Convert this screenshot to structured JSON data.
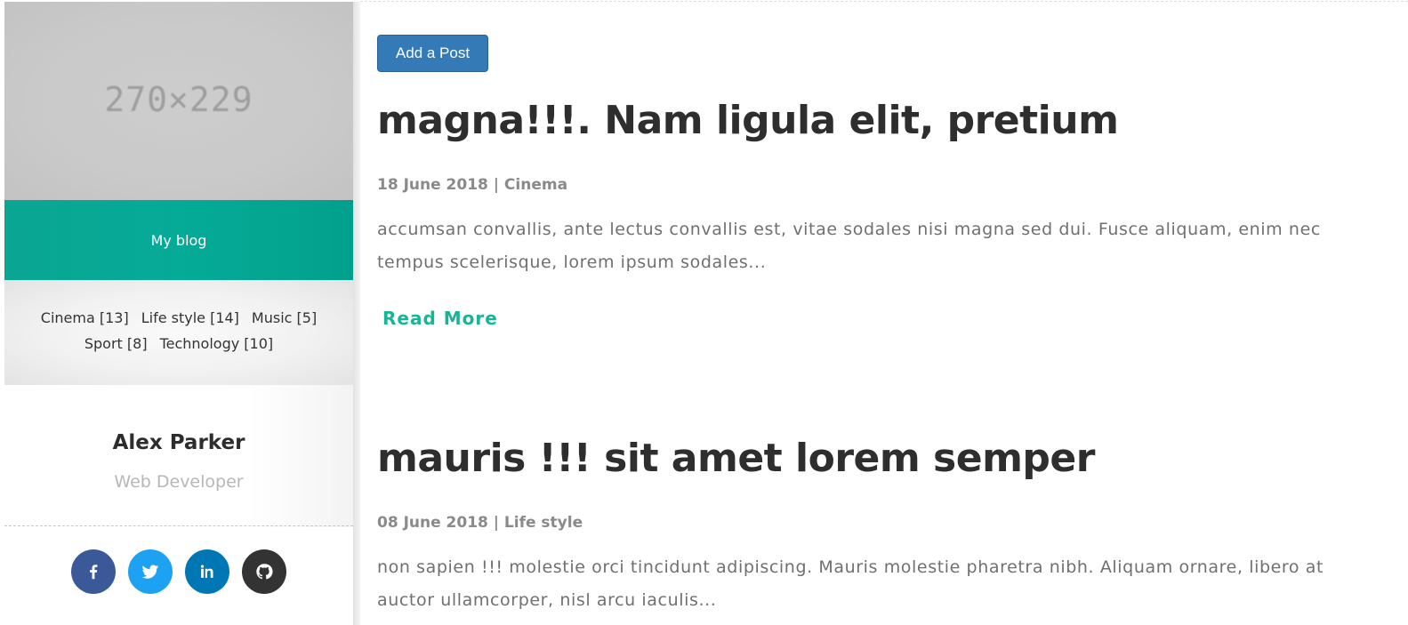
{
  "sidebar": {
    "photo_placeholder": "270×229",
    "blog_label": "My blog",
    "categories": [
      {
        "label": "Cinema [13]"
      },
      {
        "label": "Life style [14]"
      },
      {
        "label": "Music [5]"
      },
      {
        "label": "Sport [8]"
      },
      {
        "label": "Technology [10]"
      }
    ],
    "profile": {
      "name": "Alex Parker",
      "role": "Web Developer"
    },
    "socials": [
      {
        "icon": "facebook-icon",
        "color": "#3b5998"
      },
      {
        "icon": "twitter-icon",
        "color": "#1da1f2"
      },
      {
        "icon": "linkedin-icon",
        "color": "#0077b5"
      },
      {
        "icon": "github-icon",
        "color": "#333333"
      }
    ]
  },
  "main": {
    "add_post_label": "Add a Post",
    "posts": [
      {
        "title": "magna!!!. Nam ligula elit, pretium",
        "meta": "18 June 2018 | Cinema",
        "excerpt": "accumsan convallis, ante lectus convallis est, vitae sodales nisi magna sed dui. Fusce aliquam, enim nec tempus scelerisque, lorem ipsum sodales...",
        "read_more": "Read More"
      },
      {
        "title": "mauris !!! sit amet lorem semper",
        "meta": "08 June 2018 | Life style",
        "excerpt": "non sapien !!! molestie orci tincidunt adipiscing. Mauris molestie pharetra nibh. Aliquam ornare, libero at auctor ullamcorper, nisl arcu iaculis..."
      }
    ]
  },
  "colors": {
    "accent": "#05ab97",
    "button": "#337ab7",
    "read_more": "#17b596"
  }
}
